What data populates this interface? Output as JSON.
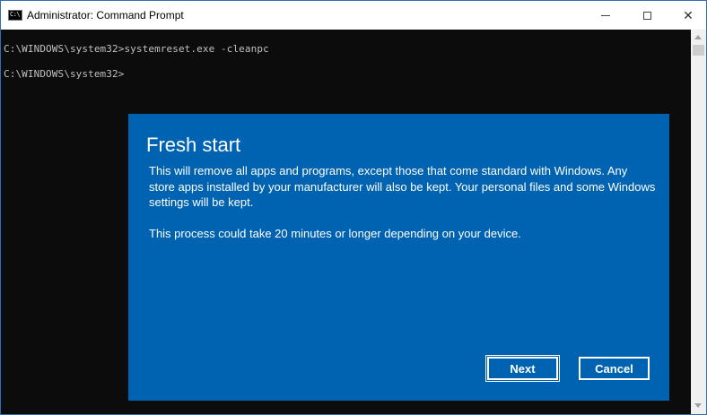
{
  "window": {
    "title": "Administrator: Command Prompt",
    "icon_label": "C:\\",
    "controls": {
      "minimize": "minimize-icon",
      "maximize": "maximize-icon",
      "close": "close-icon",
      "close_glyph": "✕"
    }
  },
  "console": {
    "lines": [
      "C:\\WINDOWS\\system32>systemreset.exe -cleanpc",
      "C:\\WINDOWS\\system32>"
    ]
  },
  "dialog": {
    "title": "Fresh start",
    "paragraphs": [
      "This will remove all apps and programs, except those that come standard with Windows. Any store apps installed by your manufacturer will also be kept. Your personal files and some Windows settings will be kept.",
      "This process could take 20 minutes or longer depending on your device."
    ],
    "buttons": {
      "next": "Next",
      "cancel": "Cancel"
    }
  },
  "colors": {
    "dialog_background": "#0063b1",
    "console_background": "#0c0c0c",
    "console_text": "#c0c0c0"
  }
}
